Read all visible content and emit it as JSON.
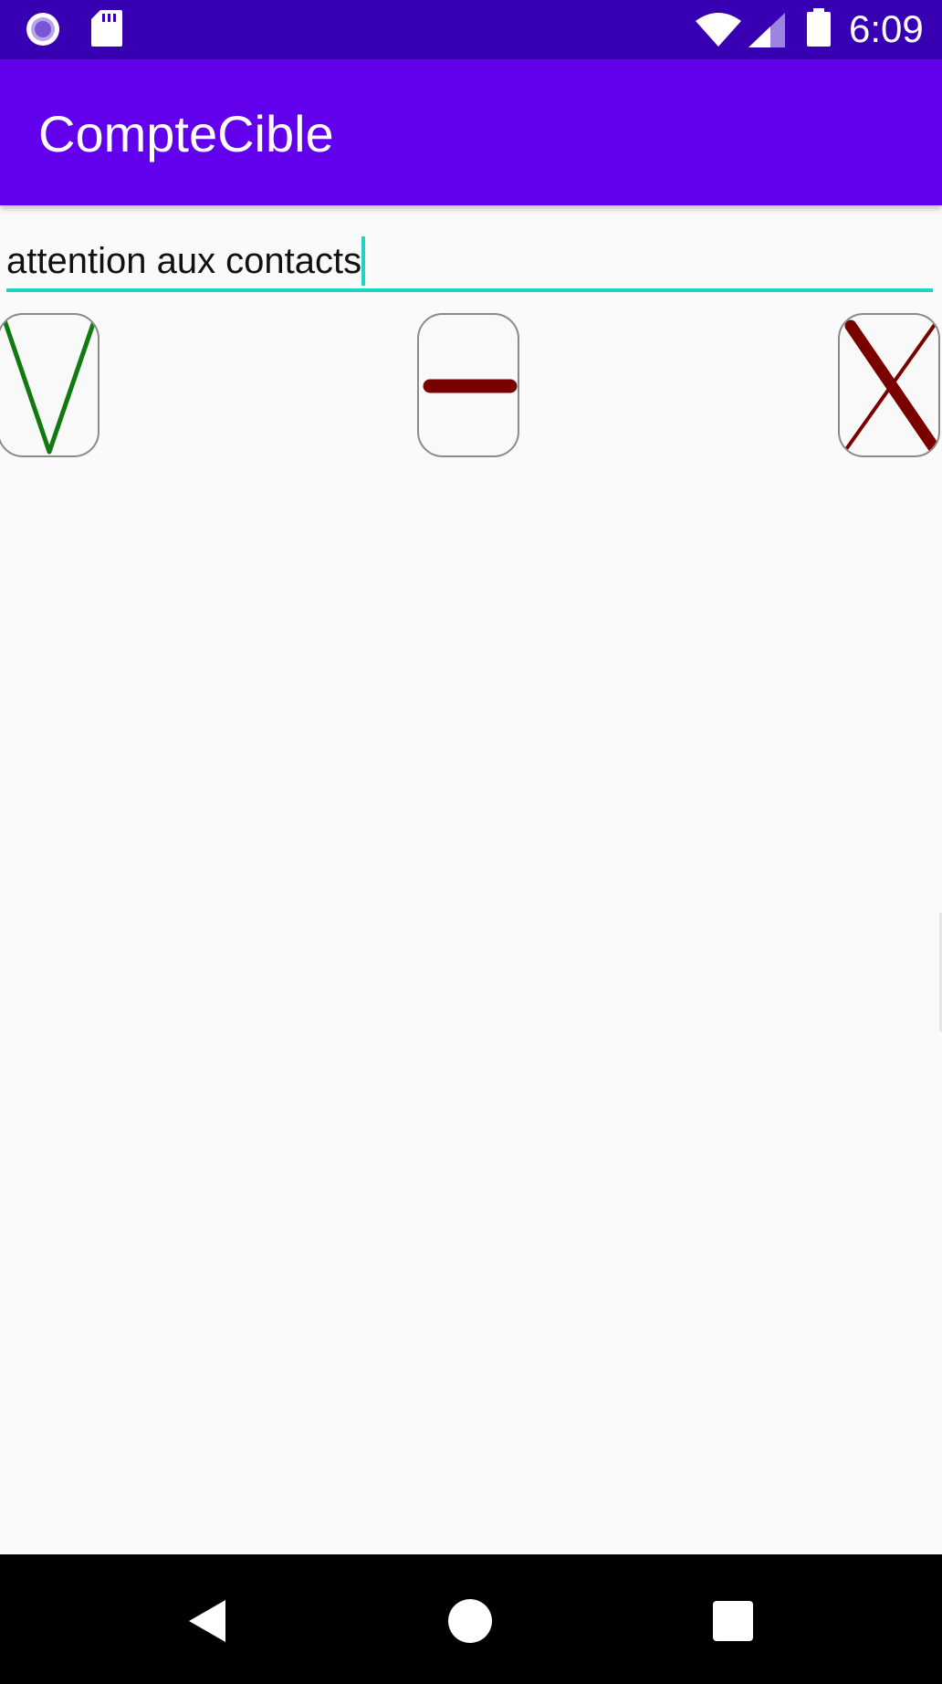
{
  "status_bar": {
    "time": "6:09",
    "icons": [
      "assistant-circle-icon",
      "sd-card-icon",
      "wifi-icon",
      "cell-signal-icon",
      "battery-icon"
    ]
  },
  "app_bar": {
    "title": "CompteCible"
  },
  "text_field": {
    "value": "attention aux contacts"
  },
  "actions": [
    {
      "name": "check-v-button",
      "icon": "v-check-icon",
      "color": "#107A0E"
    },
    {
      "name": "neutral-dash-button",
      "icon": "dash-icon",
      "color": "#7A0000"
    },
    {
      "name": "cross-x-button",
      "icon": "x-cross-icon",
      "color": "#7A0000"
    }
  ],
  "colors": {
    "status_bar": "#3700B3",
    "app_bar": "#6200EE",
    "accent": "#1DD3C2",
    "background": "#FAFAFA",
    "nav_bar": "#000000"
  },
  "nav_bar": {
    "icons": [
      "back-icon",
      "home-icon",
      "recents-icon"
    ]
  }
}
